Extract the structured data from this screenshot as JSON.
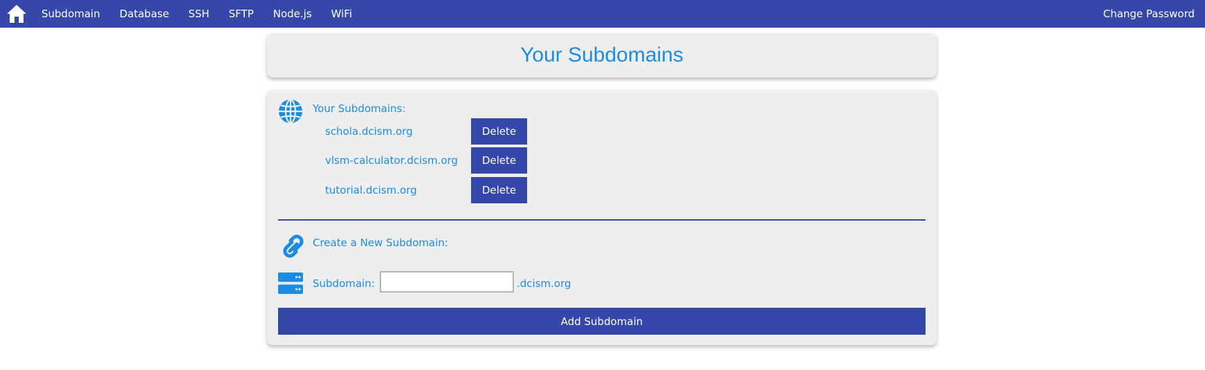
{
  "nav": {
    "home_icon": "home-icon",
    "items": [
      {
        "label": "Subdomain"
      },
      {
        "label": "Database"
      },
      {
        "label": "SSH"
      },
      {
        "label": "SFTP"
      },
      {
        "label": "Node.js"
      },
      {
        "label": "WiFi"
      }
    ],
    "change_password": "Change Password"
  },
  "page": {
    "title": "Your Subdomains"
  },
  "subdomains": {
    "heading": "Your Subdomains:",
    "icon": "globe-icon",
    "items": [
      {
        "name": "schola.dcism.org",
        "delete_label": "Delete"
      },
      {
        "name": "vlsm-calculator.dcism.org",
        "delete_label": "Delete"
      },
      {
        "name": "tutorial.dcism.org",
        "delete_label": "Delete"
      }
    ]
  },
  "create": {
    "heading": "Create a New Subdomain:",
    "heading_icon": "link-icon",
    "field_icon": "server-icon",
    "field_label": "Subdomain:",
    "field_value": "",
    "suffix": ".dcism.org",
    "submit_label": "Add Subdomain"
  },
  "colors": {
    "primary": "#3548a9",
    "accent": "#1b8ce3",
    "card_bg": "#eeeeee"
  }
}
